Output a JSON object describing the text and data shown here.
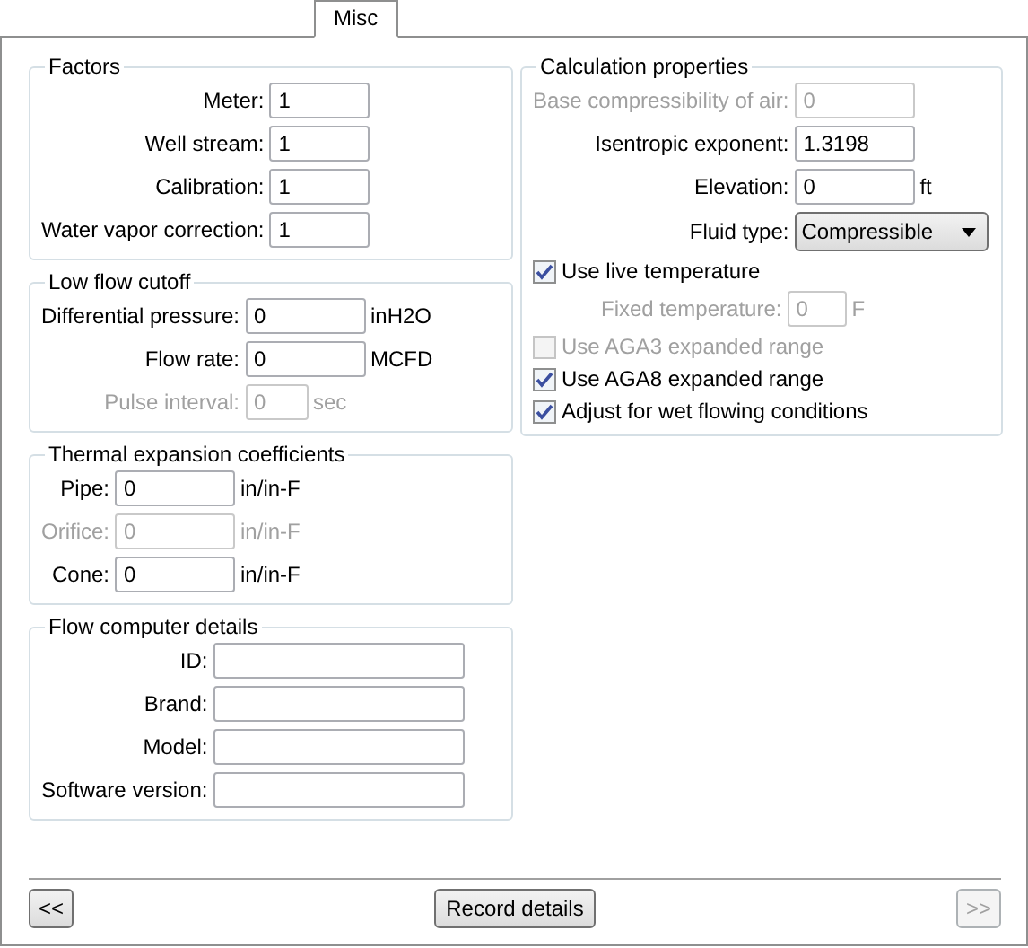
{
  "tabs": [
    {
      "label": "Misc",
      "selected": true
    }
  ],
  "columns": [
    {
      "groups": [
        {
          "title": "Factors",
          "rows": [
            {
              "kind": "field",
              "label": "Meter:",
              "value": "1",
              "disabled": false
            },
            {
              "kind": "field",
              "label": "Well stream:",
              "value": "1",
              "disabled": false
            },
            {
              "kind": "field",
              "label": "Calibration:",
              "value": "1",
              "disabled": false
            },
            {
              "kind": "field",
              "label": "Water vapor correction:",
              "value": "1",
              "disabled": false
            }
          ]
        },
        {
          "title": "Low flow cutoff",
          "rows": [
            {
              "kind": "field",
              "label": "Differential pressure:",
              "value": "0",
              "unit": "inH2O",
              "disabled": false
            },
            {
              "kind": "field",
              "label": "Flow rate:",
              "value": "0",
              "unit": "MCFD",
              "disabled": false
            },
            {
              "kind": "short-field",
              "label": "Pulse interval:",
              "value": "0",
              "unit": "sec",
              "disabled": true
            }
          ]
        },
        {
          "title": "Thermal expansion coefficients",
          "rows": [
            {
              "kind": "field",
              "label": "Pipe:",
              "value": "0",
              "unit": "in/in-F",
              "disabled": false
            },
            {
              "kind": "field",
              "label": "Orifice:",
              "value": "0",
              "unit": "in/in-F",
              "disabled": true
            },
            {
              "kind": "field",
              "label": "Cone:",
              "value": "0",
              "unit": "in/in-F",
              "disabled": false
            }
          ]
        },
        {
          "title": "Flow computer details",
          "rows": [
            {
              "kind": "field",
              "label": "ID:",
              "value": "",
              "disabled": false
            },
            {
              "kind": "field",
              "label": "Brand:",
              "value": "",
              "disabled": false
            },
            {
              "kind": "field",
              "label": "Model:",
              "value": "",
              "disabled": false
            },
            {
              "kind": "field",
              "label": "Software version:",
              "value": "",
              "disabled": false
            }
          ]
        }
      ]
    },
    {
      "groups": [
        {
          "title": "Calculation properties",
          "rows": [
            {
              "kind": "field",
              "label": "Base compressibility of air:",
              "value": "0",
              "disabled": true
            },
            {
              "kind": "field",
              "label": "Isentropic exponent:",
              "value": "1.3198",
              "disabled": false
            },
            {
              "kind": "field",
              "label": "Elevation:",
              "value": "0",
              "unit": "ft",
              "disabled": false
            },
            {
              "kind": "dropdown",
              "label": "Fluid type:",
              "value": "Compressible"
            },
            {
              "kind": "checkbox",
              "label": "Use live temperature",
              "checked": true,
              "disabled": false
            },
            {
              "kind": "indented-field",
              "label": "Fixed temperature:",
              "value": "0",
              "unit": "F",
              "disabled": true
            },
            {
              "kind": "checkbox",
              "label": "Use AGA3 expanded range",
              "checked": false,
              "disabled": true
            },
            {
              "kind": "checkbox",
              "label": "Use AGA8 expanded range",
              "checked": true,
              "disabled": false
            },
            {
              "kind": "checkbox",
              "label": "Adjust for wet flowing conditions",
              "checked": true,
              "disabled": false
            }
          ]
        }
      ]
    }
  ],
  "footer": {
    "buttons": [
      {
        "label": "<<",
        "disabled": false
      },
      {
        "label": "Record details",
        "disabled": false
      },
      {
        "label": ">>",
        "disabled": true
      }
    ]
  }
}
